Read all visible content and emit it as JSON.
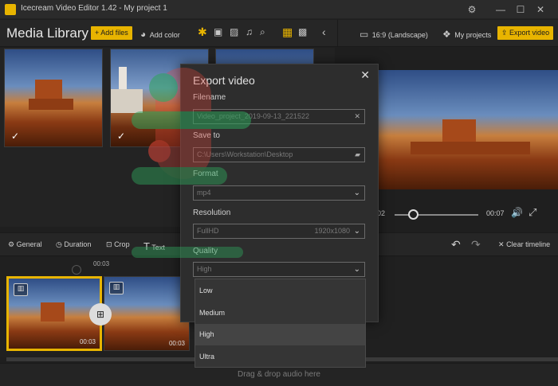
{
  "window": {
    "title": "Icecream Video Editor 1.42 - My project 1",
    "settings_icon": "gear-icon",
    "controls": [
      "—",
      "☐",
      "✕"
    ]
  },
  "toolbar": {
    "media_library": "Media Library",
    "add_files": "Add files",
    "add_color": "Add color",
    "aspect": "16:9 (Landscape)",
    "my_projects": "My projects",
    "export_video": "Export video"
  },
  "editbar": {
    "general": "General",
    "duration": "Duration",
    "crop": "Crop",
    "text": "Text",
    "clear_timeline": "Clear timeline"
  },
  "preview": {
    "time_start": "02",
    "time_end": "00:07",
    "progress": 0.22
  },
  "timeline": {
    "ruler_time": "00:03",
    "clips": [
      {
        "duration": "00:03"
      },
      {
        "duration": "00:03"
      }
    ],
    "audio_hint": "Drag & drop audio here"
  },
  "export_dialog": {
    "title": "Export video",
    "filename_label": "Filename",
    "filename_value": "Video_project_2019-09-13_221522",
    "saveto_label": "Save to",
    "saveto_value": "C:\\Users\\Workstation\\Desktop",
    "format_label": "Format",
    "format_value": "mp4",
    "resolution_label": "Resolution",
    "resolution_value": "FullHD",
    "resolution_size": "1920x1080",
    "quality_label": "Quality",
    "quality_value": "High",
    "quality_options": [
      "Low",
      "Medium",
      "High",
      "Ultra"
    ],
    "quality_highlighted": "High"
  },
  "colors": {
    "accent": "#e8b400",
    "background": "#1f1f1f",
    "dialog": "#2d2d2d"
  }
}
